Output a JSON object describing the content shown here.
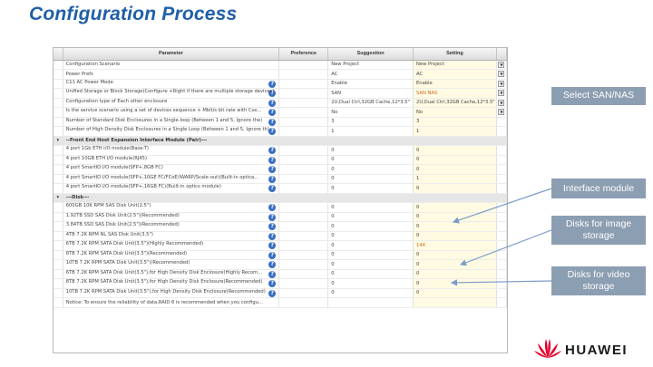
{
  "slide": {
    "title": "Configuration Process"
  },
  "table": {
    "headers": [
      "Parameter",
      "Preference",
      "Suggestion",
      "Setting"
    ],
    "rows": [
      {
        "param": "Configuration Scenario",
        "pref": "",
        "sugg": "New Project",
        "set": "New Project",
        "help": false,
        "dd": true
      },
      {
        "param": "Power Prefs",
        "pref": "",
        "sugg": "AC",
        "set": "AC",
        "help": false,
        "dd": true
      },
      {
        "param": "C11 AC Power Mode",
        "pref": "",
        "sugg": "Enable",
        "set": "Enable",
        "help": true,
        "dd": true
      },
      {
        "param": "Unified Storage or Block Storage(Configure +Right if there are multiple storage devices)",
        "pref": "",
        "sugg": "SAN",
        "set": "SAN NAS",
        "help": true,
        "dd": true,
        "hl": true
      },
      {
        "param": "Configuration type of Each other enclosure",
        "pref": "",
        "sugg": "2U,Dual Ctrl,32GB Cache,12*3.5\"",
        "set": "2U,Dual Ctrl,32GB Cache,12*3.5\"",
        "help": true,
        "dd": true
      },
      {
        "param": "Is the service scenario using a set of devices sequence + Mbit/s bit rate with Cse...",
        "pref": "",
        "sugg": "No",
        "set": "No",
        "help": true,
        "dd": true
      },
      {
        "param": "Number of Standard Disk Enclosures in a Single-loop (Between 1 and 5, Ignore the)",
        "pref": "",
        "sugg": "3",
        "set": "3",
        "help": true,
        "dd": false
      },
      {
        "param": "Number of High Density Disk Enclosures in a Single Loop (Between 1 and 5, Ignore th)",
        "pref": "",
        "sugg": "1",
        "set": "1",
        "help": true,
        "dd": false
      },
      {
        "group": "--Front End Host Expansion Interface Module (Pair)---"
      },
      {
        "param": "4 port 1Gb ETH I/O module(Base-T)",
        "pref": "",
        "sugg": "0",
        "set": "0",
        "help": true,
        "dd": false
      },
      {
        "param": "4 port 10GB ETH I/O module(RJ45)",
        "pref": "",
        "sugg": "0",
        "set": "0",
        "help": true,
        "dd": false
      },
      {
        "param": "4 port SmartIO I/O module(SFP+,8GB FC)",
        "pref": "",
        "sugg": "0",
        "set": "0",
        "help": true,
        "dd": false
      },
      {
        "param": "4 port SmartIO I/O module(SFP+,10GE FC/FCoE/iWARP/Scale-out)(Built-in optica...",
        "pref": "",
        "sugg": "0",
        "set": "1",
        "help": true,
        "dd": false
      },
      {
        "param": "4 port SmartIO I/O module(SFP+,16GB FC)(Built-in optics module)",
        "pref": "",
        "sugg": "0",
        "set": "0",
        "help": true,
        "dd": false
      },
      {
        "group": "---Disk---"
      },
      {
        "param": "600GB 10K RPM SAS Disk Unit(2.5\")",
        "pref": "",
        "sugg": "0",
        "set": "0",
        "help": true,
        "dd": false
      },
      {
        "param": "1.92TB SSD SAS Disk Unit(2.5\")(Recommended)",
        "pref": "",
        "sugg": "0",
        "set": "0",
        "help": true,
        "dd": false
      },
      {
        "param": "3.84TB SSD SAS Disk Unit(2.5\")(Recommended)",
        "pref": "",
        "sugg": "0",
        "set": "0",
        "help": true,
        "dd": false
      },
      {
        "param": "4TB 7.2K RPM NL SAS Disk Unit(3.5\")",
        "pref": "",
        "sugg": "0",
        "set": "0",
        "help": true,
        "dd": false
      },
      {
        "param": "6TB 7.2K RPM SATA Disk Unit(3.5\")(Highly Recommended)",
        "pref": "",
        "sugg": "0",
        "set": "144",
        "help": true,
        "dd": false,
        "hl": true
      },
      {
        "param": "8TB 7.2K RPM SATA Disk Unit(3.5\")(Recommended)",
        "pref": "",
        "sugg": "0",
        "set": "0",
        "help": true,
        "dd": false
      },
      {
        "param": "10TB 7.2K RPM SATA Disk Unit(3.5\")(Recommended)",
        "pref": "",
        "sugg": "0",
        "set": "0",
        "help": true,
        "dd": false
      },
      {
        "param": "6TB 7.2K RPM SATA Disk Unit(3.5\"),for High Density Disk Enclosure(Highly Recom...",
        "pref": "",
        "sugg": "0",
        "set": "0",
        "help": true,
        "dd": false
      },
      {
        "param": "8TB 7.2K RPM SATA Disk Unit(3.5\"),for High Density Disk Enclosure(Recommended)",
        "pref": "",
        "sugg": "0",
        "set": "0",
        "help": true,
        "dd": false
      },
      {
        "param": "10TB 7.2K RPM SATA Disk Unit(3.5\"),for High Density Disk Enclosure(Recommended)",
        "pref": "",
        "sugg": "0",
        "set": "0",
        "help": true,
        "dd": false
      },
      {
        "param": "Notice: To ensure the reliability of data,RAID 6 is recommended when you configu...",
        "pref": "",
        "sugg": "",
        "set": "",
        "help": false,
        "dd": false
      }
    ]
  },
  "callouts": {
    "select": "Select SAN/NAS",
    "interface": "Interface module",
    "image": "Disks for image storage",
    "video": "Disks for video storage"
  },
  "logo": {
    "text": "HUAWEI",
    "color": "#e4002b"
  }
}
